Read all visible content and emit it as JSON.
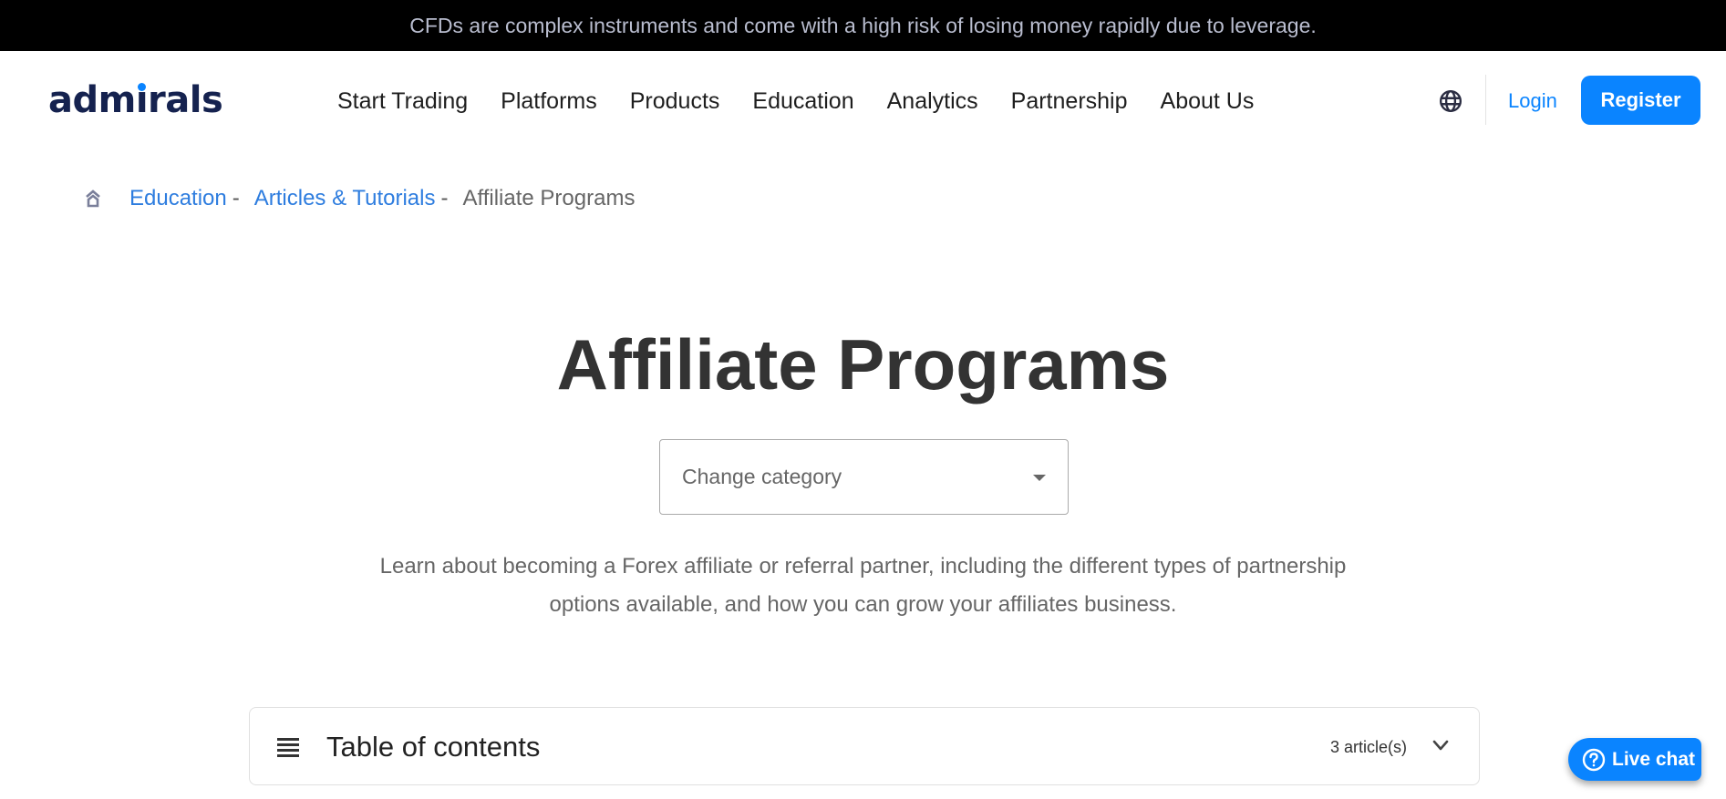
{
  "banner": {
    "text": "CFDs are complex instruments and come with a high risk of losing money rapidly due to leverage."
  },
  "header": {
    "logo": "admirals",
    "logo_parts": {
      "before": "adm",
      "i": "ı",
      "after": "rals"
    },
    "nav": [
      {
        "label": "Start Trading"
      },
      {
        "label": "Platforms"
      },
      {
        "label": "Products"
      },
      {
        "label": "Education"
      },
      {
        "label": "Analytics"
      },
      {
        "label": "Partnership"
      },
      {
        "label": "About Us"
      }
    ],
    "language_icon": "globe-icon",
    "login_label": "Login",
    "register_label": "Register"
  },
  "breadcrumb": {
    "home_icon": "home-icon",
    "items": [
      {
        "label": "Education",
        "separator": "-"
      },
      {
        "label": "Articles & Tutorials",
        "separator": "-"
      }
    ],
    "current": "Affiliate Programs"
  },
  "page": {
    "title": "Affiliate Programs",
    "category_select": {
      "placeholder": "Change category"
    },
    "description": "Learn about becoming a Forex affiliate or referral partner, including the different types of partnership options available, and how you can grow your affiliates business."
  },
  "toc": {
    "title": "Table of contents",
    "count": "3 article(s)",
    "icon": "list-icon",
    "toggle_icon": "chevron-down-icon"
  },
  "live_chat": {
    "label": "Live chat",
    "icon": "question-circle-icon"
  },
  "colors": {
    "brand_navy": "#15224f",
    "accent_blue": "#0a84ff",
    "link_blue": "#2e7ddf",
    "banner_bg": "#000000"
  }
}
